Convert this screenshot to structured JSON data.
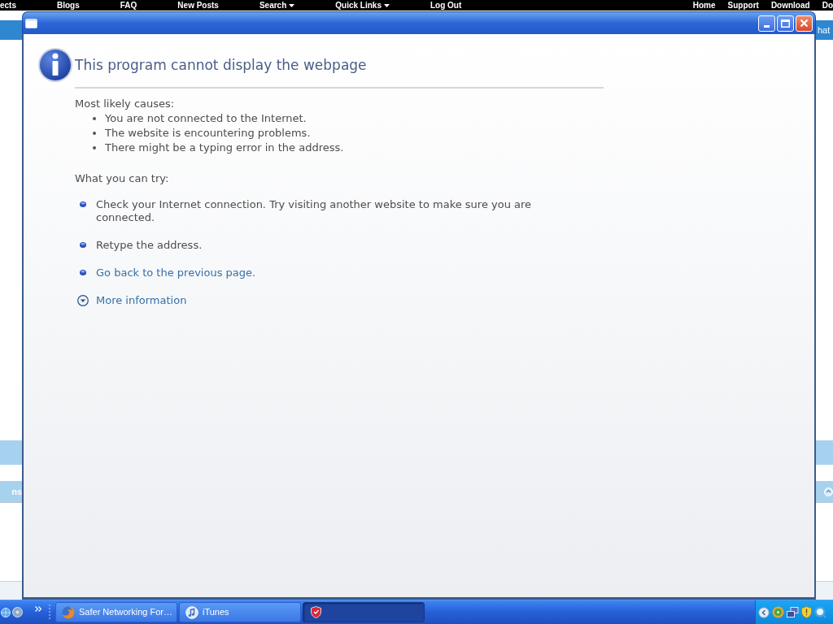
{
  "site_nav": {
    "left_links": [
      {
        "label": "ects",
        "dropdown": false
      },
      {
        "label": "Blogs",
        "dropdown": false
      },
      {
        "label": "FAQ",
        "dropdown": false
      },
      {
        "label": "New Posts",
        "dropdown": false
      },
      {
        "label": "Search",
        "dropdown": true
      },
      {
        "label": "Quick Links",
        "dropdown": true
      },
      {
        "label": "Log Out",
        "dropdown": false
      }
    ],
    "right_links": [
      {
        "label": "Home"
      },
      {
        "label": "Support"
      },
      {
        "label": "Download"
      },
      {
        "label": "Do"
      }
    ]
  },
  "site_left_edge": {
    "tab_label": "ns"
  },
  "site_right_edge": {
    "header_label": "hat"
  },
  "error_page": {
    "heading": "This program cannot display the webpage",
    "causes": {
      "title": "Most likely causes:",
      "items": [
        "You are not connected to the Internet.",
        "The website is encountering problems.",
        "There might be a typing error in the address."
      ]
    },
    "suggestions": {
      "title": "What you can try:",
      "items": [
        {
          "kind": "text",
          "text": "Check your Internet connection. Try visiting another website to make sure you are connected."
        },
        {
          "kind": "text",
          "text": "Retype the address."
        },
        {
          "kind": "link",
          "text": "Go back to the previous page."
        },
        {
          "kind": "expander",
          "text": "More information",
          "expanded": false
        }
      ]
    }
  },
  "taskbar": {
    "tasks": [
      {
        "label": "Safer Networking For…",
        "selected": false
      },
      {
        "label": "iTunes",
        "selected": false
      },
      {
        "selected": true
      }
    ]
  }
}
